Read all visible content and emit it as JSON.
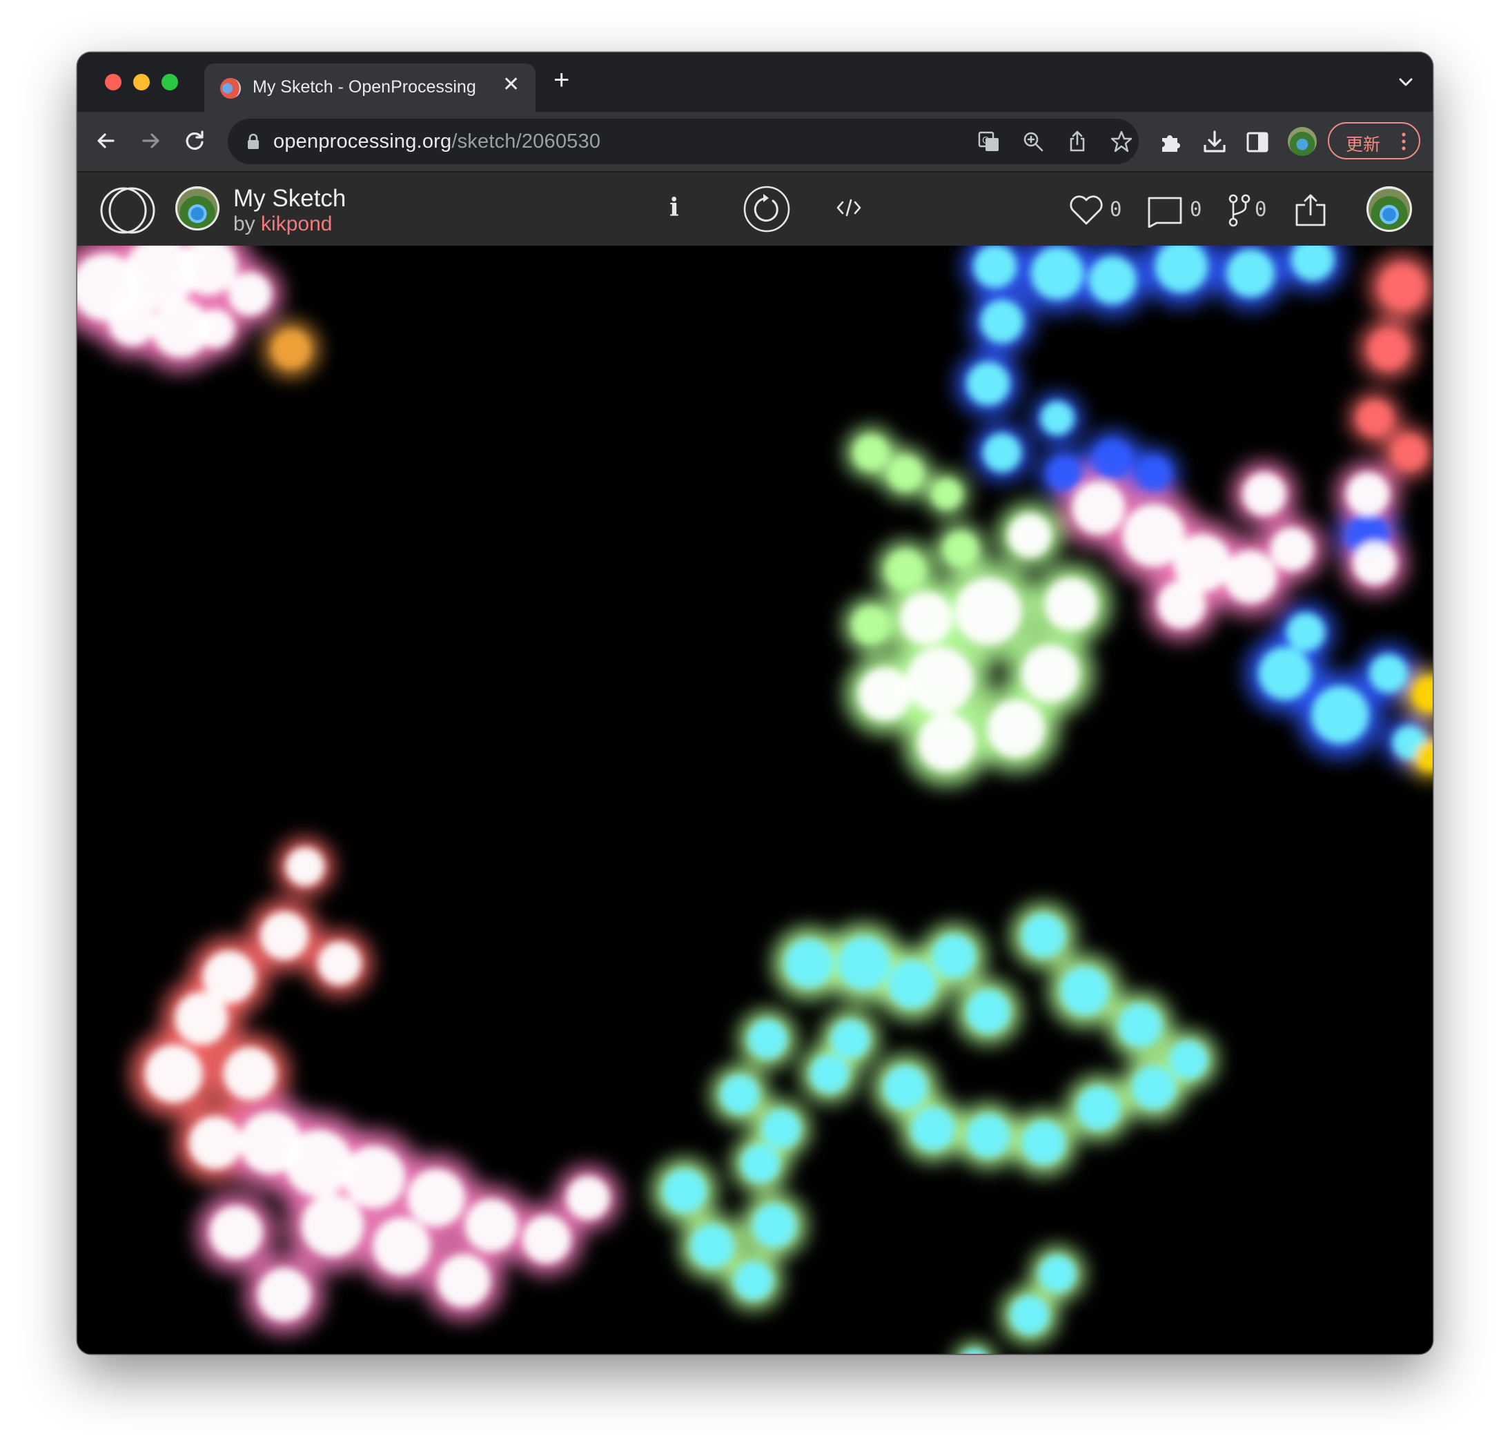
{
  "browser": {
    "tab_title": "My Sketch - OpenProcessing",
    "tab_close": "✕",
    "new_tab": "+",
    "url_host": "openprocessing.org",
    "url_path": "/sketch/2060530",
    "update_label": "更新"
  },
  "header": {
    "sketch_title": "My Sketch",
    "by_prefix": "by ",
    "author": "kikpond",
    "info_label": "i",
    "likes_count": "0",
    "comments_count": "0",
    "forks_count": "0"
  },
  "icons": {
    "browser": [
      "back-icon",
      "forward-icon",
      "reload-icon",
      "lock-icon",
      "translate-icon",
      "zoom-icon",
      "share-icon",
      "star-icon",
      "extensions-icon",
      "download-icon",
      "sidepanel-icon",
      "profile-icon",
      "more-icon",
      "tab-search-icon"
    ],
    "header": [
      "openprocessing-logo-icon",
      "info-icon",
      "restart-icon",
      "code-icon",
      "heart-icon",
      "comment-icon",
      "fork-icon",
      "share-icon"
    ]
  },
  "colors": {
    "canvas_background": "#000000",
    "author_link": "#f27a7a",
    "blob_palette": [
      "#ffffff",
      "#f07ab8",
      "#f0a13a",
      "#2f5bff",
      "#6ff2ff",
      "#b6ff9a",
      "#ff6a6a",
      "#ffd400"
    ]
  }
}
